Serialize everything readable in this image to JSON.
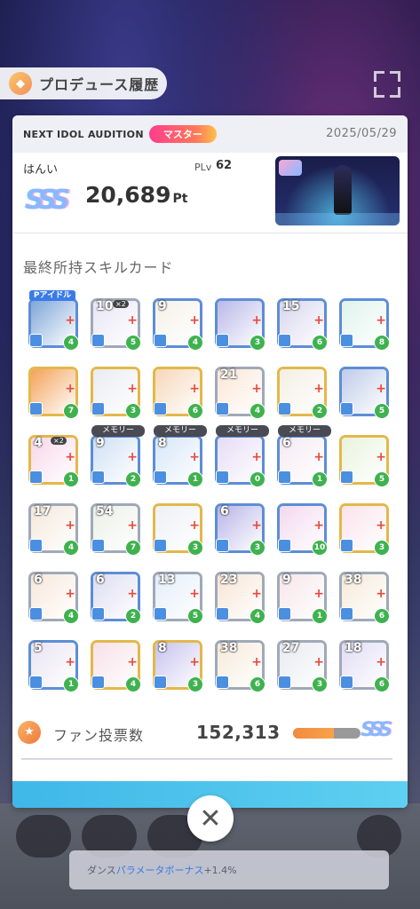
{
  "header": {
    "title": "プロデュース履歴"
  },
  "audition": {
    "name": "NEXT IDOL AUDITION",
    "rank_badge": "マスター",
    "date": "2025/05/29"
  },
  "player": {
    "name": "はんい",
    "plv_label": "PLv",
    "plv_value": "62",
    "rank": "SSS",
    "score": "20,689",
    "score_unit": "Pt"
  },
  "skill_section": {
    "title": "最終所持スキルカード"
  },
  "cards": [
    {
      "level": "",
      "tag": "",
      "ptag": "Pアイドル",
      "mini": "",
      "bubble": "4",
      "frame": "blue",
      "color": "#7fa6d9"
    },
    {
      "level": "10",
      "tag": "",
      "ptag": "",
      "mini": "×2",
      "bubble": "5",
      "frame": "silver",
      "color": "#e8e6f6"
    },
    {
      "level": "9",
      "tag": "",
      "ptag": "",
      "mini": "",
      "bubble": "4",
      "frame": "blue",
      "color": "#f5f1e8"
    },
    {
      "level": "",
      "tag": "",
      "ptag": "",
      "mini": "",
      "bubble": "3",
      "frame": "blue",
      "color": "#b9b8e8"
    },
    {
      "level": "15",
      "tag": "",
      "ptag": "",
      "mini": "",
      "bubble": "6",
      "frame": "blue",
      "color": "#d7d5ee"
    },
    {
      "level": "",
      "tag": "",
      "ptag": "",
      "mini": "",
      "bubble": "8",
      "frame": "blue",
      "color": "#dff3ec"
    },
    {
      "level": "",
      "tag": "",
      "ptag": "",
      "mini": "",
      "bubble": "7",
      "frame": "gold",
      "color": "#f4a25a"
    },
    {
      "level": "",
      "tag": "",
      "ptag": "",
      "mini": "",
      "bubble": "3",
      "frame": "gold",
      "color": "#e9ecf2"
    },
    {
      "level": "",
      "tag": "",
      "ptag": "",
      "mini": "",
      "bubble": "6",
      "frame": "gold",
      "color": "#f6d7b9"
    },
    {
      "level": "21",
      "tag": "",
      "ptag": "",
      "mini": "",
      "bubble": "4",
      "frame": "silver",
      "color": "#fbe6d6"
    },
    {
      "level": "",
      "tag": "",
      "ptag": "",
      "mini": "",
      "bubble": "2",
      "frame": "gold",
      "color": "#f3efe3"
    },
    {
      "level": "",
      "tag": "",
      "ptag": "",
      "mini": "",
      "bubble": "5",
      "frame": "blue",
      "color": "#bfcbe9"
    },
    {
      "level": "4",
      "tag": "",
      "ptag": "",
      "mini": "×2",
      "bubble": "1",
      "frame": "gold",
      "color": "#f7d7ea"
    },
    {
      "level": "9",
      "tag": "メモリー",
      "ptag": "",
      "mini": "",
      "bubble": "2",
      "frame": "blue",
      "color": "#cfe0f5"
    },
    {
      "level": "8",
      "tag": "メモリー",
      "ptag": "",
      "mini": "",
      "bubble": "1",
      "frame": "blue",
      "color": "#d6e6f7"
    },
    {
      "level": "",
      "tag": "メモリー",
      "ptag": "",
      "mini": "",
      "bubble": "0",
      "frame": "blue",
      "color": "#e6dcf7"
    },
    {
      "level": "6",
      "tag": "メモリー",
      "ptag": "",
      "mini": "",
      "bubble": "1",
      "frame": "blue",
      "color": "#f5eaf2"
    },
    {
      "level": "",
      "tag": "",
      "ptag": "",
      "mini": "",
      "bubble": "5",
      "frame": "gold",
      "color": "#e9f3dc"
    },
    {
      "level": "17",
      "tag": "",
      "ptag": "",
      "mini": "",
      "bubble": "4",
      "frame": "silver",
      "color": "#f5e7da"
    },
    {
      "level": "54",
      "tag": "",
      "ptag": "",
      "mini": "",
      "bubble": "7",
      "frame": "silver",
      "color": "#eaf0e6"
    },
    {
      "level": "",
      "tag": "",
      "ptag": "",
      "mini": "",
      "bubble": "3",
      "frame": "gold",
      "color": "#eef0f4"
    },
    {
      "level": "6",
      "tag": "",
      "ptag": "",
      "mini": "",
      "bubble": "3",
      "frame": "blue",
      "color": "#b8b4e8"
    },
    {
      "level": "",
      "tag": "",
      "ptag": "",
      "mini": "",
      "bubble": "10",
      "frame": "blue",
      "color": "#f3d8ef"
    },
    {
      "level": "",
      "tag": "",
      "ptag": "",
      "mini": "",
      "bubble": "3",
      "frame": "gold",
      "color": "#fbe3ec"
    },
    {
      "level": "6",
      "tag": "",
      "ptag": "",
      "mini": "",
      "bubble": "4",
      "frame": "silver",
      "color": "#f8e7da"
    },
    {
      "level": "6",
      "tag": "",
      "ptag": "",
      "mini": "",
      "bubble": "2",
      "frame": "blue",
      "color": "#dedcf2"
    },
    {
      "level": "13",
      "tag": "",
      "ptag": "",
      "mini": "",
      "bubble": "5",
      "frame": "silver",
      "color": "#e3eef9"
    },
    {
      "level": "23",
      "tag": "",
      "ptag": "",
      "mini": "",
      "bubble": "4",
      "frame": "silver",
      "color": "#f8e4d4"
    },
    {
      "level": "9",
      "tag": "",
      "ptag": "",
      "mini": "",
      "bubble": "1",
      "frame": "silver",
      "color": "#f7e6ea"
    },
    {
      "level": "38",
      "tag": "",
      "ptag": "",
      "mini": "",
      "bubble": "6",
      "frame": "silver",
      "color": "#f6ead9"
    },
    {
      "level": "5",
      "tag": "",
      "ptag": "",
      "mini": "",
      "bubble": "1",
      "frame": "blue",
      "color": "#e8e4f2"
    },
    {
      "level": "",
      "tag": "",
      "ptag": "",
      "mini": "",
      "bubble": "4",
      "frame": "gold",
      "color": "#f7e0e9"
    },
    {
      "level": "8",
      "tag": "",
      "ptag": "",
      "mini": "",
      "bubble": "3",
      "frame": "gold",
      "color": "#c7c2ef"
    },
    {
      "level": "38",
      "tag": "",
      "ptag": "",
      "mini": "",
      "bubble": "6",
      "frame": "silver",
      "color": "#f6ead9"
    },
    {
      "level": "27",
      "tag": "",
      "ptag": "",
      "mini": "",
      "bubble": "3",
      "frame": "silver",
      "color": "#e6eaf0"
    },
    {
      "level": "18",
      "tag": "",
      "ptag": "",
      "mini": "",
      "bubble": "6",
      "frame": "silver",
      "color": "#e1dcf5"
    }
  ],
  "fan_votes": {
    "label": "ファン投票数",
    "value": "152,313",
    "progress_fraction": 0.6,
    "rank": "SSS"
  },
  "background_banner": {
    "text_prefix": "ダンス",
    "text_highlight": "パラメータボーナス",
    "text_suffix": "+1.4%"
  },
  "close_label": "✕"
}
